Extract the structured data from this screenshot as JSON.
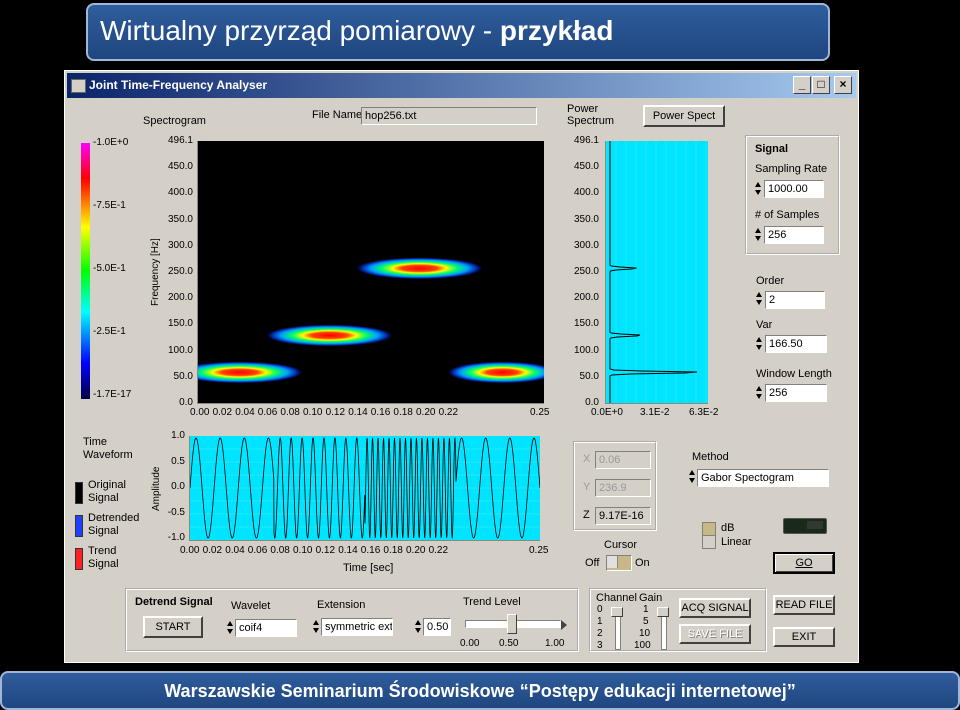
{
  "slide": {
    "title_prefix": "Wirtualny przyrząd pomiarowy - ",
    "title_bold": "przykład",
    "footer": "Warszawskie Seminarium Środowiskowe “Postępy edukacji internetowej”"
  },
  "window": {
    "title": "Joint Time-Frequency Analyser",
    "minimize": "_",
    "maximize": "□",
    "close": "×"
  },
  "spectrogram": {
    "label": "Spectrogram",
    "ylabel": "Frequency [Hz]",
    "yticks": [
      "496.1",
      "450.0",
      "400.0",
      "350.0",
      "300.0",
      "250.0",
      "200.0",
      "150.0",
      "100.0",
      "50.0",
      "0.0"
    ],
    "xticks": [
      "0.00",
      "0.02",
      "0.04",
      "0.06",
      "0.08",
      "0.10",
      "0.12",
      "0.14",
      "0.16",
      "0.18",
      "0.20",
      "0.22",
      "0.25"
    ],
    "colorbar_ticks": [
      "-1.0E+0",
      "-7.5E-1",
      "-5.0E-1",
      "-2.5E-1",
      "-1.7E-17"
    ]
  },
  "file": {
    "label": "File Name",
    "value": "hop256.txt"
  },
  "power_spectrum": {
    "label_line1": "Power",
    "label_line2": "Spectrum",
    "button": "Power Spect",
    "yticks": [
      "496.1",
      "450.0",
      "400.0",
      "350.0",
      "300.0",
      "250.0",
      "200.0",
      "150.0",
      "100.0",
      "50.0",
      "0.0"
    ],
    "xticks": [
      "0.0E+0",
      "3.1E-2",
      "6.3E-2"
    ]
  },
  "signal_panel": {
    "title": "Signal",
    "sampling_rate_label": "Sampling Rate",
    "sampling_rate": "1000.00",
    "samples_label": "# of Samples",
    "samples": "256"
  },
  "order": {
    "label": "Order",
    "value": "2"
  },
  "var": {
    "label": "Var",
    "value": "166.50"
  },
  "window_length": {
    "label": "Window Length",
    "value": "256"
  },
  "waveform": {
    "label_line1": "Time",
    "label_line2": "Waveform",
    "ylabel": "Amplitude",
    "xlabel": "Time [sec]",
    "yticks": [
      "1.0",
      "0.5",
      "0.0",
      "-0.5",
      "-1.0"
    ],
    "xticks": [
      "0.00",
      "0.02",
      "0.04",
      "0.06",
      "0.08",
      "0.10",
      "0.12",
      "0.14",
      "0.16",
      "0.18",
      "0.20",
      "0.22",
      "0.25"
    ]
  },
  "legend": {
    "original": [
      "Original",
      "Signal"
    ],
    "detrended": [
      "Detrended",
      "Signal"
    ],
    "trend": [
      "Trend",
      "Signal"
    ],
    "colors": {
      "original": "#000000",
      "detrended": "#2040ff",
      "trend": "#ff2020"
    }
  },
  "cursor_readout": {
    "x_label": "X",
    "x_value": "0.06",
    "y_label": "Y",
    "y_value": "236.9",
    "z_label": "Z",
    "z_value": "9.17E-16"
  },
  "cursor": {
    "label": "Cursor",
    "off": "Off",
    "on": "On"
  },
  "method": {
    "label": "Method",
    "value": "Gabor Spectogram"
  },
  "scale": {
    "db": "dB",
    "linear": "Linear"
  },
  "go_button": "GO",
  "detrend": {
    "title": "Detrend Signal",
    "start_button": "START",
    "wavelet_label": "Wavelet",
    "wavelet_value": "coif4",
    "extension_label": "Extension",
    "extension_value": "symmetric ext",
    "trend_value": "0.50",
    "trend_level_label": "Trend Level",
    "trend_ticks": [
      "0.00",
      "0.50",
      "1.00"
    ]
  },
  "channel": {
    "label": "Channel",
    "ticks": [
      "0",
      "1",
      "2",
      "3"
    ]
  },
  "gain": {
    "label": "Gain",
    "ticks": [
      "1",
      "5",
      "10",
      "100"
    ]
  },
  "acq_button": "ACQ SIGNAL",
  "save_button": "SAVE FILE",
  "read_button": "READ FILE",
  "exit_button": "EXIT",
  "colors": {
    "plot_bg": "#00e4ff",
    "spectrogram_bg": "#000000",
    "accent": "#0a246a"
  }
}
